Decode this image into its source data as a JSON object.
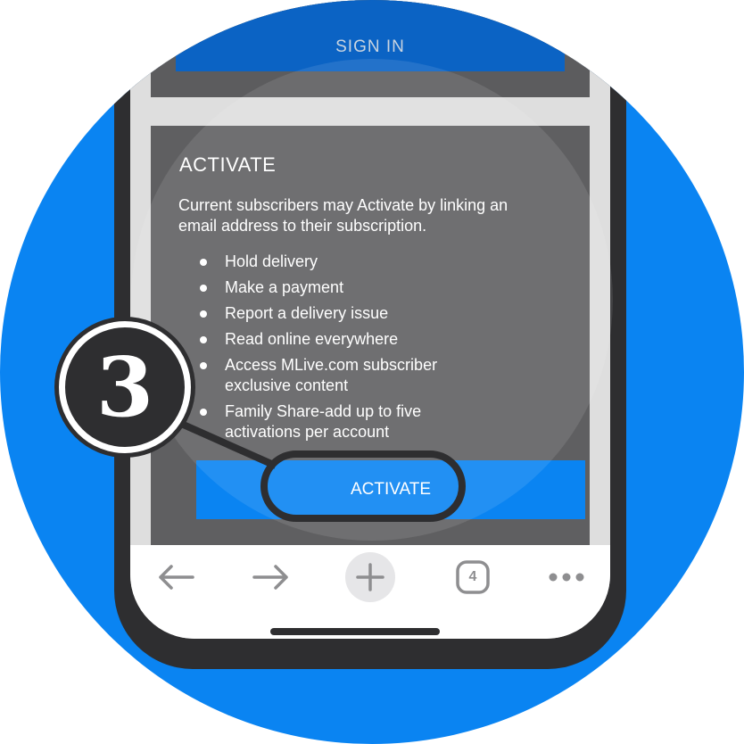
{
  "top_card": {
    "signin_label": "SIGN IN"
  },
  "activate_card": {
    "title": "ACTIVATE",
    "description": "Current subscribers may Activate by linking an email address to their subscription.",
    "features": [
      "Hold delivery",
      "Make a payment",
      "Report a delivery issue",
      "Read online everywhere",
      "Access MLive.com subscriber exclusive content",
      "Family Share-add up to five activations per account"
    ],
    "button_label": "ACTIVATE"
  },
  "browser_toolbar": {
    "icons": [
      "back-arrow-icon",
      "forward-arrow-icon",
      "new-tab-plus-icon",
      "tab-count-icon",
      "more-options-icon"
    ],
    "tab_count": "4"
  },
  "callout": {
    "step_number": "3"
  },
  "colors": {
    "background_circle": "#0a84f2",
    "phone_frame": "#2e2e30",
    "card": "#5f5f61",
    "signin_button": "#0b63c4",
    "activate_button": "#0a84f2"
  }
}
